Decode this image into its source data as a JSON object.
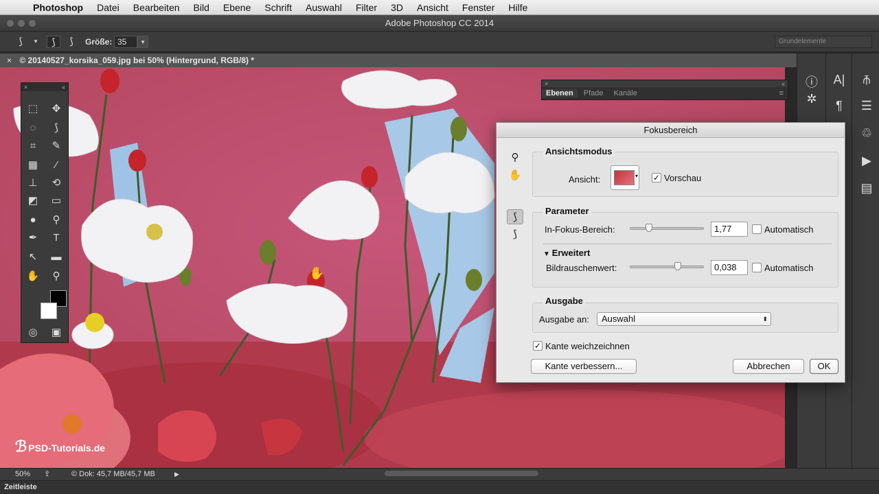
{
  "menubar": {
    "app_name": "Photoshop",
    "items": [
      "Datei",
      "Bearbeiten",
      "Bild",
      "Ebene",
      "Schrift",
      "Auswahl",
      "Filter",
      "3D",
      "Ansicht",
      "Fenster",
      "Hilfe"
    ]
  },
  "window": {
    "title": "Adobe Photoshop CC 2014"
  },
  "options_bar": {
    "size_label": "Größe:",
    "size_value": "35",
    "workspace": "Grundelemente"
  },
  "document": {
    "tab_title": "© 20140527_korsika_059.jpg bei 50% (Hintergrund, RGB/8) *"
  },
  "layers_panel": {
    "tabs": [
      "Ebenen",
      "Pfade",
      "Kanäle"
    ]
  },
  "dialog": {
    "title": "Fokusbereich",
    "view_mode": {
      "heading": "Ansichtsmodus",
      "view_label": "Ansicht:",
      "preview_label": "Vorschau",
      "preview_checked": true
    },
    "parameters": {
      "heading": "Parameter",
      "in_focus_label": "In-Fokus-Bereich:",
      "in_focus_value": "1,77",
      "in_focus_slider": 0.22,
      "auto_label": "Automatisch",
      "advanced_label": "Erweitert",
      "noise_label": "Bildrauschenwert:",
      "noise_value": "0,038",
      "noise_slider": 0.65,
      "auto_label_2": "Automatisch"
    },
    "output": {
      "heading": "Ausgabe",
      "output_to_label": "Ausgabe an:",
      "output_to_value": "Auswahl"
    },
    "soften_edge_label": "Kante weichzeichnen",
    "soften_edge_checked": true,
    "refine_edge_button": "Kante verbessern...",
    "cancel_button": "Abbrechen",
    "ok_button": "OK"
  },
  "status_bar": {
    "zoom": "50%",
    "doc_info": "© Dok: 45,7 MB/45,7 MB"
  },
  "timeline": {
    "label": "Zeitleiste"
  },
  "watermark": {
    "text": "PSD-Tutorials.de"
  },
  "colors": {
    "canvas_mask": "#c24b6d",
    "ui_dark": "#3b3b3b",
    "dialog_bg": "#e8e8e8"
  }
}
